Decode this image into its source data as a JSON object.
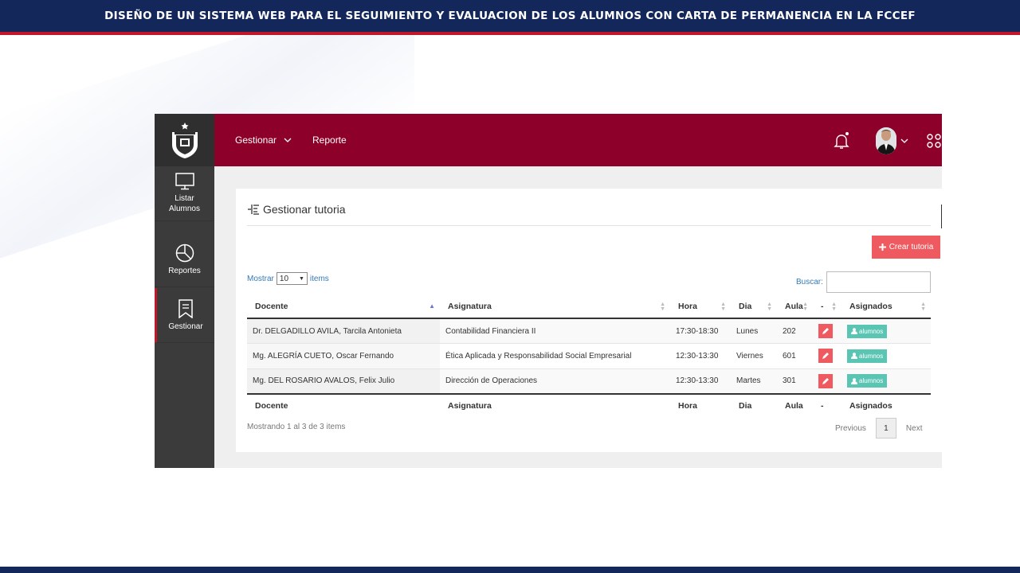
{
  "slide": {
    "title": "DISEÑO DE UN SISTEMA WEB PARA EL SEGUIMIENTO Y EVALUACION DE LOS ALUMNOS CON CARTA DE PERMANENCIA EN LA FCCEF"
  },
  "sidebar": {
    "logo_icon": "university-crest-icon",
    "items": [
      {
        "label_1": "Listar",
        "label_2": "Alumnos",
        "icon": "monitor-icon"
      },
      {
        "label_1": "Reportes",
        "icon": "pie-chart-icon"
      },
      {
        "label_1": "Gestionar",
        "icon": "bookmark-icon",
        "active": true
      }
    ]
  },
  "topbar": {
    "nav": [
      {
        "label": "Gestionar"
      },
      {
        "label": "Reporte"
      }
    ],
    "accent_color": "#8d0029"
  },
  "panel": {
    "title": "Gestionar tutoria",
    "create_button": "Crear tutoria",
    "show_label": "Mostrar",
    "show_value": "10",
    "items_label": "items",
    "search_label": "Buscar:",
    "search_value": "",
    "columns": [
      "Docente",
      "Asignatura",
      "Hora",
      "Dia",
      "Aula",
      "-",
      "Asignados"
    ],
    "rows": [
      {
        "docente": "Dr. DELGADILLO AVILA, Tarcila Antonieta",
        "asignatura": "Contabilidad Financiera II",
        "hora": "17:30-18:30",
        "dia": "Lunes",
        "aula": "202",
        "asignados": "alumnos"
      },
      {
        "docente": "Mg. ALEGRÍA CUETO, Oscar Fernando",
        "asignatura": "Ética Aplicada y Responsabilidad Social Empresarial",
        "hora": "12:30-13:30",
        "dia": "Viernes",
        "aula": "601",
        "asignados": "alumnos"
      },
      {
        "docente": "Mg. DEL ROSARIO AVALOS, Felix Julio",
        "asignatura": "Dirección de Operaciones",
        "hora": "12:30-13:30",
        "dia": "Martes",
        "aula": "301",
        "asignados": "alumnos"
      }
    ],
    "info": "Mostrando 1 al 3 de 3 items",
    "pager": {
      "previous": "Previous",
      "current": "1",
      "next": "Next"
    }
  }
}
